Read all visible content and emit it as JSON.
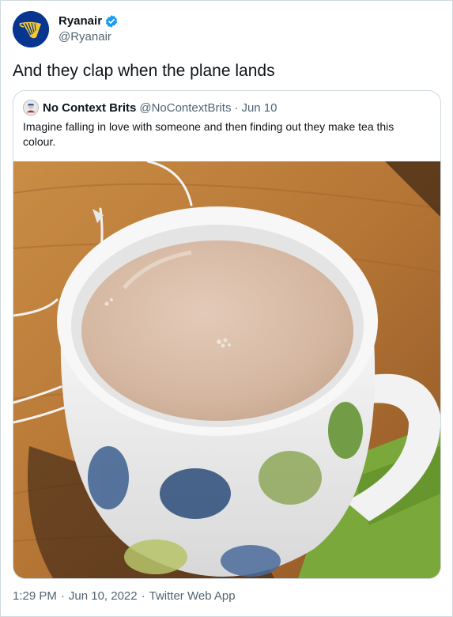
{
  "author": {
    "display_name": "Ryanair",
    "handle": "@Ryanair",
    "verified": true,
    "avatar_icon": "ryanair-harp-logo-icon",
    "brand_color": "#073590"
  },
  "tweet": {
    "text": "And they clap when the plane lands"
  },
  "quoted_tweet": {
    "display_name": "No Context Brits",
    "handle": "@NoContextBrits",
    "separator": "·",
    "date": "Jun 10",
    "text": "Imagine falling in love with someone and then finding out they make tea this colour.",
    "image_icon": "milky-tea-mug-photo"
  },
  "footer": {
    "time": "1:29 PM",
    "separator": "·",
    "date": "Jun 10, 2022",
    "separator2": "·",
    "source": "Twitter Web App"
  },
  "colors": {
    "text": "#0f1419",
    "secondary": "#536471",
    "border": "#cfd9de",
    "verified_blue": "#1d9bf0"
  }
}
